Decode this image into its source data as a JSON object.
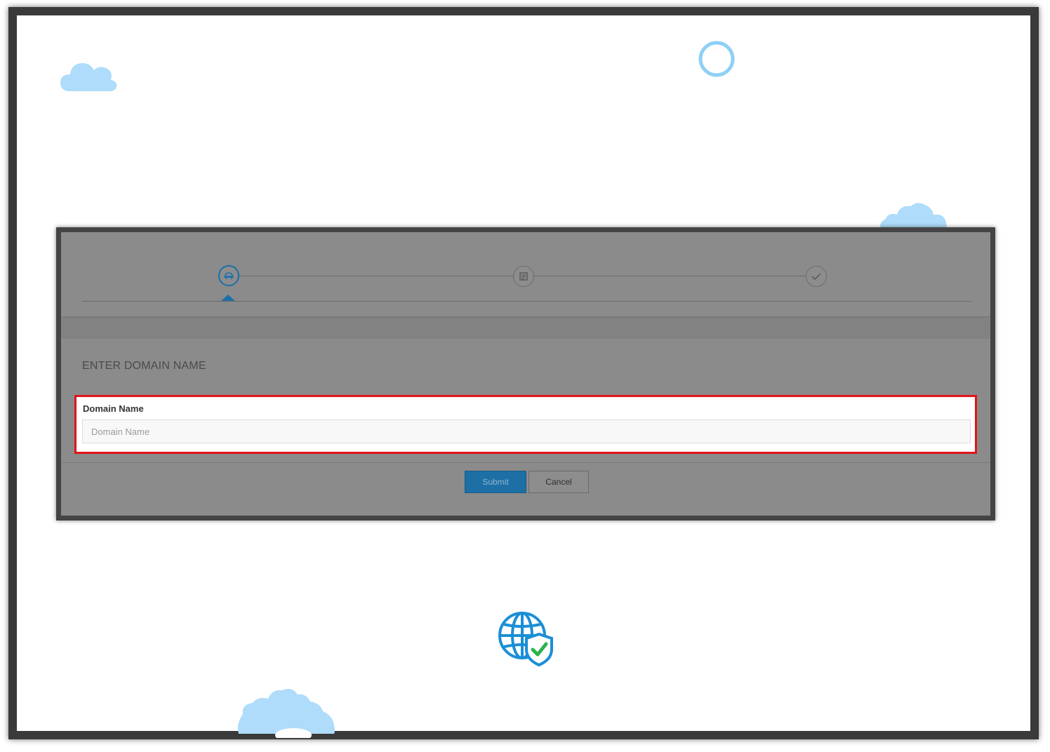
{
  "wizard": {
    "steps": [
      {
        "icon": "domain-settings-icon",
        "active": true
      },
      {
        "icon": "form-icon",
        "active": false
      },
      {
        "icon": "checkmark-icon",
        "active": false
      }
    ]
  },
  "form": {
    "section_title": "ENTER DOMAIN NAME",
    "domain_label": "Domain Name",
    "domain_placeholder": "Domain Name",
    "domain_value": ""
  },
  "actions": {
    "submit_label": "Submit",
    "cancel_label": "Cancel"
  },
  "colors": {
    "accent": "#1d6fa5",
    "highlight": "#e0141b",
    "decor": "#aedcfa"
  },
  "decorations": [
    "cloud-icon",
    "ring-icon",
    "cloud-icon",
    "gear-icon",
    "globe-shield-icon"
  ]
}
